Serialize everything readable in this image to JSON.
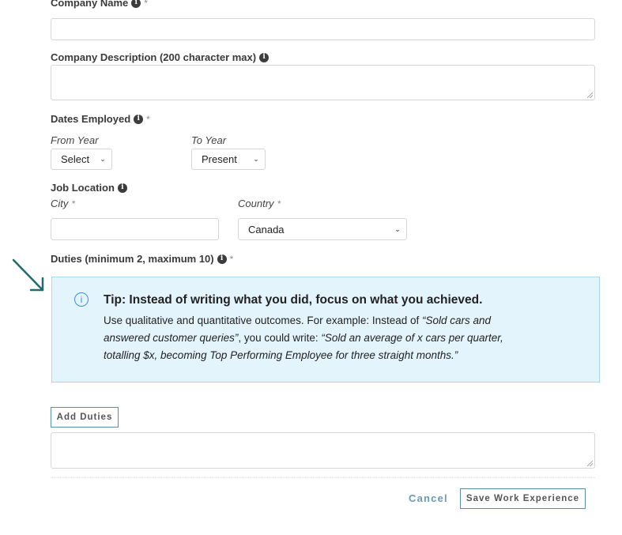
{
  "company_name": {
    "label": "Company Name",
    "value": "",
    "required": "*"
  },
  "company_description": {
    "label": "Company Description (200 character max)",
    "value": ""
  },
  "dates_employed": {
    "label": "Dates Employed",
    "required": "*",
    "from_year": {
      "label": "From Year",
      "selected": "Select"
    },
    "to_year": {
      "label": "To Year",
      "selected": "Present"
    }
  },
  "job_location": {
    "label": "Job Location",
    "city": {
      "label": "City",
      "required": "*",
      "value": ""
    },
    "country": {
      "label": "Country",
      "required": "*",
      "selected": "Canada"
    }
  },
  "duties": {
    "label": "Duties (minimum 2, maximum 10)",
    "required": "*",
    "add_button": "Add Duties",
    "value": ""
  },
  "tip": {
    "title": "Tip: Instead of writing what you did, focus on what you achieved.",
    "body_1": "Use qualitative and quantitative outcomes. For example: Instead of ",
    "quote_1_line1": "“Sold cars and",
    "quote_1_line2": "answered customer queries”",
    "body_2": ", you could write: ",
    "quote_2_line1": "“Sold an average of x cars per quarter,",
    "quote_2_line2": "totalling $x, becoming Top Performing Employee for three straight months.”",
    "accent_color": "#3b8fd8"
  },
  "annotation_arrow": {
    "color": "#1f6b6e"
  },
  "actions": {
    "cancel": "Cancel",
    "save": "Save Work Experience"
  },
  "icons": {
    "info": "i",
    "chevron": "⌄"
  }
}
